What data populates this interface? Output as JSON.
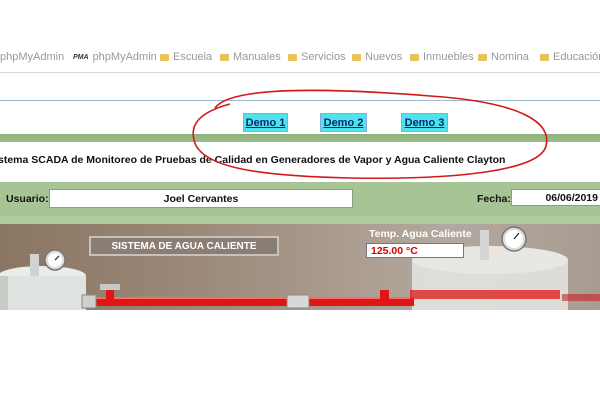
{
  "bookmarks": [
    {
      "label": "phpMyAdmin",
      "icon": "pma-icon"
    },
    {
      "label": "phpMyAdmin",
      "icon": "pma-icon"
    },
    {
      "label": "Escuela",
      "icon": "folder-icon"
    },
    {
      "label": "Manuales",
      "icon": "folder-icon"
    },
    {
      "label": "Servicios",
      "icon": "folder-icon"
    },
    {
      "label": "Nuevos",
      "icon": "folder-icon"
    },
    {
      "label": "Inmuebles",
      "icon": "folder-icon"
    },
    {
      "label": "Nomina",
      "icon": "folder-icon"
    },
    {
      "label": "Educación",
      "icon": "folder-icon"
    }
  ],
  "demo_links": [
    {
      "label": "Demo 1"
    },
    {
      "label": "Demo 2"
    },
    {
      "label": "Demo 3"
    }
  ],
  "page_title": "stema SCADA de Monitoreo de Pruebas de Calidad en Generadores de Vapor y Agua Caliente Clayton",
  "user": {
    "label": "Usuario:",
    "value": "Joel Cervantes"
  },
  "date": {
    "label": "Fecha:",
    "value": "06/06/2019"
  },
  "scene": {
    "system_label": "SISTEMA DE AGUA CALIENTE",
    "temp_title": "Temp. Agua Caliente",
    "temp_value": "125.00 °C"
  },
  "colors": {
    "demo_button": "#4fe3ee",
    "green_band": "#a7c494",
    "pipe_red": "#e01515",
    "temp_text": "#d40000",
    "annotation": "#d11a1a"
  }
}
